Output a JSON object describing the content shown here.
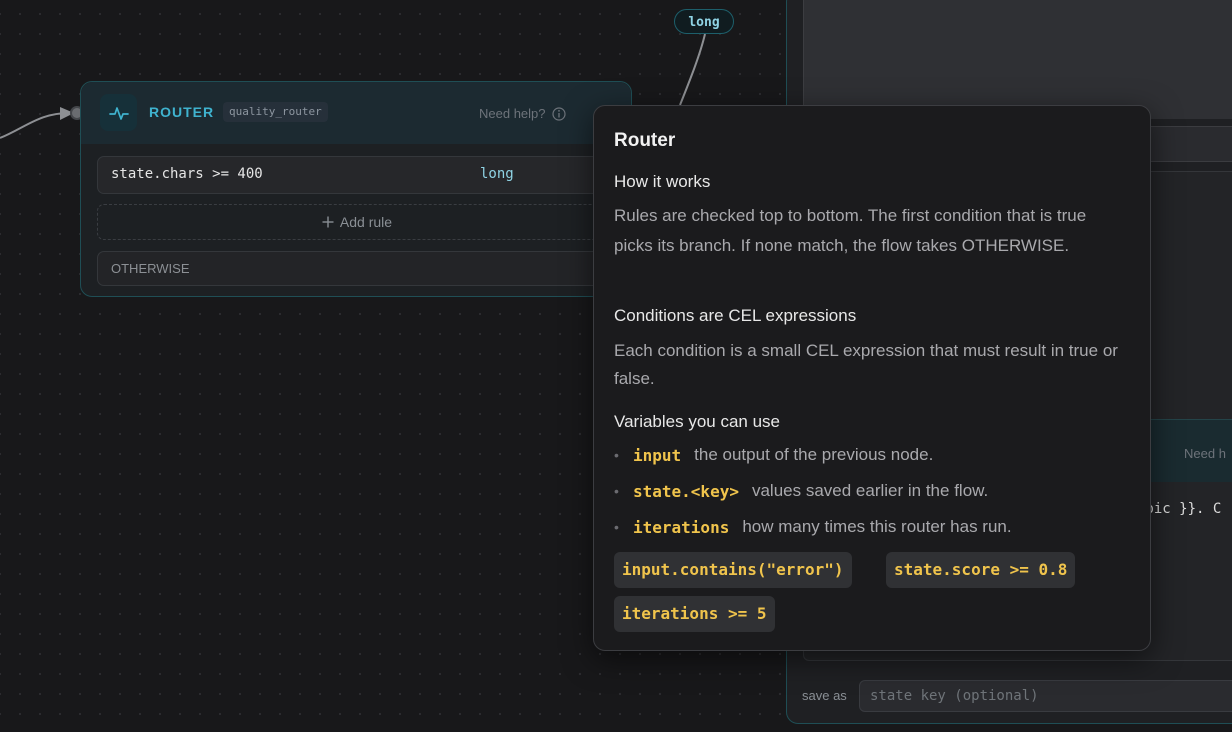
{
  "canvas": {
    "edge_label": "long"
  },
  "router_node": {
    "title": "ROUTER",
    "name": "quality_router",
    "help_label": "Need help?",
    "rules": [
      {
        "condition": "state.chars >= 400",
        "target": "long"
      }
    ],
    "add_rule_label": "Add rule",
    "otherwise_label": "OTHERWISE"
  },
  "right_node": {
    "help_label": "Need h",
    "code_fragment": "opic }}. C",
    "save_as_label": "save as",
    "state_key_placeholder": "state key (optional)"
  },
  "help_popover": {
    "title": "Router",
    "section1_heading": "How it works",
    "section1_text": "Rules are checked top to bottom. The first condition that is true picks its branch. If none match, the flow takes OTHERWISE.",
    "section2_heading": "Conditions are CEL expressions",
    "section2_text": "Each condition is a small CEL expression that must result in true or false.",
    "section3_heading": "Variables you can use",
    "variables": [
      {
        "name": "input",
        "description": "the output of the previous node."
      },
      {
        "name": "state.<key>",
        "description": "values saved earlier in the flow."
      },
      {
        "name": "iterations",
        "description": "how many times this router has run."
      }
    ],
    "examples": [
      "input.contains(\"error\")",
      "state.score >= 0.8",
      "iterations >= 5"
    ]
  },
  "colors": {
    "accent": "#3fb3cf",
    "edge_label": "#8fd3e4",
    "code_highlight": "#f0c44c"
  }
}
